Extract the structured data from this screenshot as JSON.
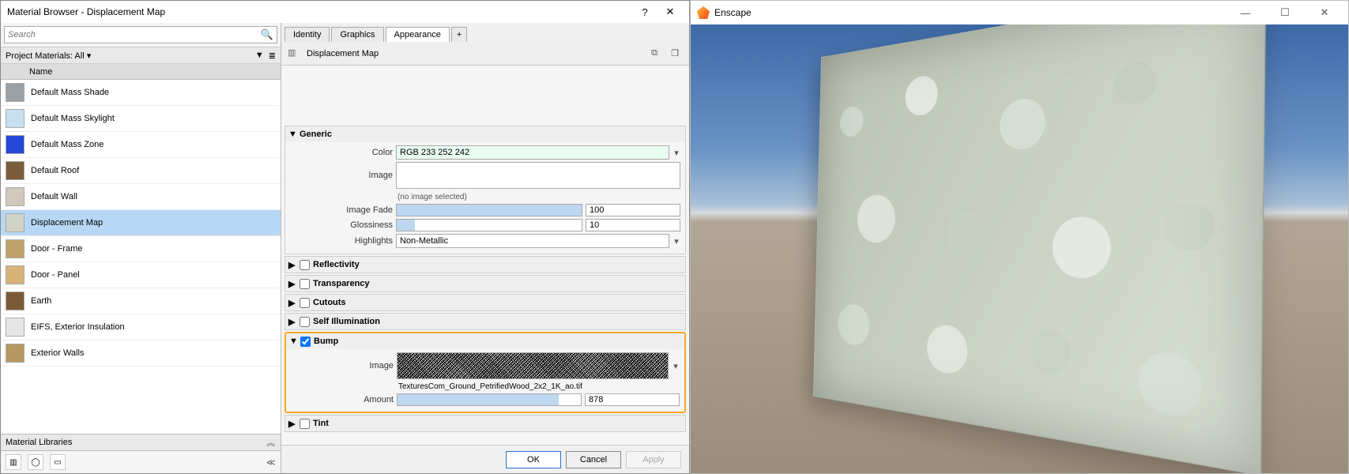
{
  "materialBrowser": {
    "windowTitle": "Material Browser - Displacement Map",
    "helpGlyph": "?",
    "closeGlyph": "✕",
    "search": {
      "placeholder": "Search",
      "iconName": "search-icon"
    },
    "projectHeader": "Project Materials: All ▾",
    "listIcon": "≣",
    "nameHeader": "Name",
    "materials": [
      {
        "label": "Default Mass Shade",
        "swatch": "#9aa0a6"
      },
      {
        "label": "Default Mass Skylight",
        "swatch": "#c6e0f0"
      },
      {
        "label": "Default Mass Zone",
        "swatch": "#2646d8"
      },
      {
        "label": "Default Roof",
        "swatch": "#7a5c3a"
      },
      {
        "label": "Default Wall",
        "swatch": "#d0c8bc"
      },
      {
        "label": "Displacement Map",
        "swatch": "#cfd3c8",
        "selected": true
      },
      {
        "label": "Door - Frame",
        "swatch": "#bfa06a"
      },
      {
        "label": "Door - Panel",
        "swatch": "#d7b37a"
      },
      {
        "label": "Earth",
        "swatch": "#7a5a36"
      },
      {
        "label": "EIFS, Exterior Insulation",
        "swatch": "#e6e6e6"
      },
      {
        "label": "Exterior Walls",
        "swatch": "#b89862"
      }
    ],
    "materialLibrariesLabel": "Material Libraries",
    "chevronUp": "︽",
    "chevronRight": "≪"
  },
  "appearance": {
    "tabs": {
      "identity": "Identity",
      "graphics": "Graphics",
      "appearance": "Appearance",
      "plus": "+"
    },
    "materialName": "Displacement Map",
    "generic": {
      "title": "Generic",
      "colorLabel": "Color",
      "colorValue": "RGB 233 252 242",
      "imageLabel": "Image",
      "noImage": "(no image selected)",
      "imageFadeLabel": "Image Fade",
      "imageFadeValue": "100",
      "glossLabel": "Glossiness",
      "glossValue": "10",
      "highlightsLabel": "Highlights",
      "highlightsValue": "Non-Metallic"
    },
    "sections": {
      "reflectivity": "Reflectivity",
      "transparency": "Transparency",
      "cutouts": "Cutouts",
      "selfIllum": "Self Illumination",
      "bump": "Bump",
      "tint": "Tint"
    },
    "bump": {
      "imageLabel": "Image",
      "imageFile": "TexturesCom_Ground_PetrifiedWood_2x2_1K_ao.tif",
      "amountLabel": "Amount",
      "amountValue": "878"
    },
    "buttons": {
      "ok": "OK",
      "cancel": "Cancel",
      "apply": "Apply"
    }
  },
  "enscape": {
    "title": "Enscape",
    "minGlyph": "—",
    "maxGlyph": "☐",
    "closeGlyph": "✕"
  }
}
